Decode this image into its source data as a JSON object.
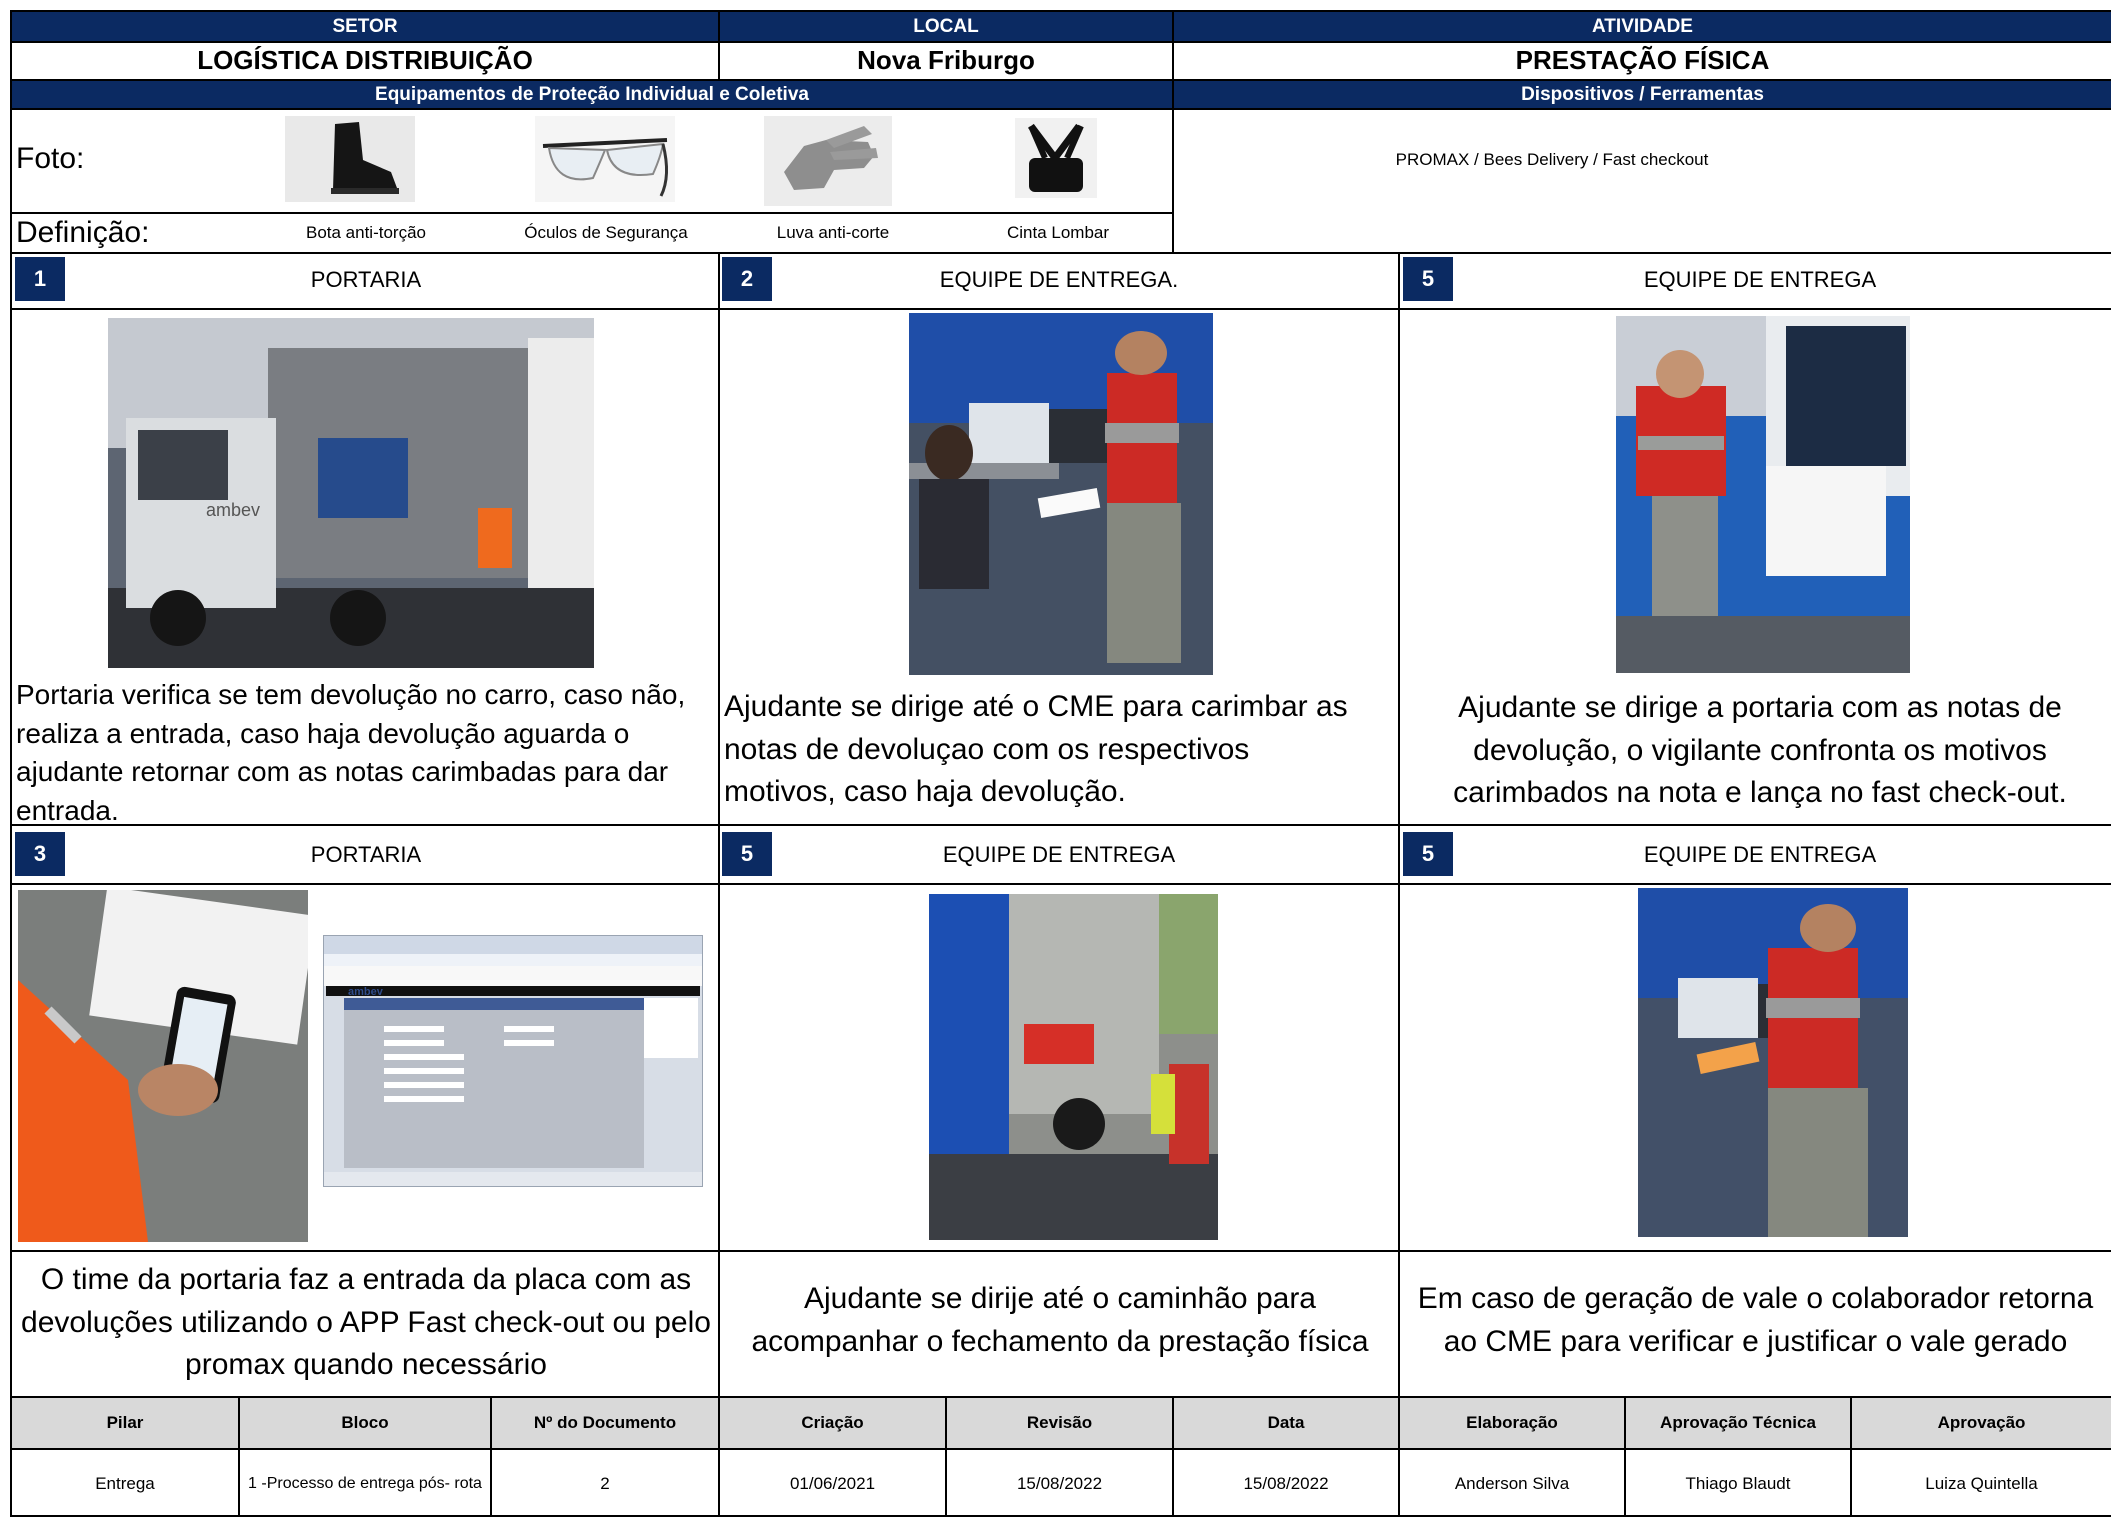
{
  "header": {
    "setor_label": "SETOR",
    "local_label": "LOCAL",
    "atividade_label": "ATIVIDADE",
    "setor_value": "LOGÍSTICA DISTRIBUIÇÃO",
    "local_value": "Nova Friburgo",
    "atividade_value": "PRESTAÇÃO FÍSICA",
    "epi_label": "Equipamentos de Proteção Individual e Coletiva",
    "tools_label": "Dispositivos / Ferramentas"
  },
  "epi": {
    "foto_label": "Foto:",
    "definicao_label": "Definição:",
    "items": [
      "Bota anti-torção",
      "Óculos de Segurança",
      "Luva anti-corte",
      "Cinta Lombar"
    ],
    "tools_value": "PROMAX / Bees Delivery / Fast checkout"
  },
  "steps": [
    {
      "number": "1",
      "title": "PORTARIA",
      "description": "Portaria verifica se tem devolução no carro, caso não, realiza a entrada, caso haja devolução aguarda o ajudante retornar com as notas carimbadas para dar entrada."
    },
    {
      "number": "2",
      "title": "EQUIPE DE ENTREGA.",
      "description": "Ajudante se dirige até o CME para carimbar as notas de devoluçao com os respectivos motivos, caso haja devolução."
    },
    {
      "number": "5",
      "title": "EQUIPE DE ENTREGA",
      "description": "Ajudante se dirige a portaria com as notas de devolução, o vigilante confronta os motivos carimbados na nota e lança no fast check-out."
    },
    {
      "number": "3",
      "title": "PORTARIA",
      "description": "O time da portaria faz a entrada da placa com as devoluções utilizando o APP Fast check-out ou pelo promax quando necessário"
    },
    {
      "number": "5",
      "title": "EQUIPE DE ENTREGA",
      "description": "Ajudante se dirije até o caminhão para acompanhar o fechamento da prestação física"
    },
    {
      "number": "5",
      "title": "EQUIPE DE ENTREGA",
      "description": "Em caso de geração de vale o colaborador retorna ao CME para verificar e justificar o vale gerado"
    }
  ],
  "footer": {
    "headers": [
      "Pilar",
      "Bloco",
      "Nº do Documento",
      "Criação",
      "Revisão",
      "Data",
      "Elaboração",
      "Aprovação Técnica",
      "Aprovação"
    ],
    "values": [
      "Entrega",
      "1 -Processo de entrega pós- rota",
      "2",
      "01/06/2021",
      "15/08/2022",
      "15/08/2022",
      "Anderson Silva",
      "Thiago Blaudt",
      "Luiza Quintella"
    ]
  },
  "screen_mock": {
    "brand": "ambev"
  },
  "colors": {
    "navy": "#0b2a62",
    "footer_gray": "#d9d9d9"
  }
}
